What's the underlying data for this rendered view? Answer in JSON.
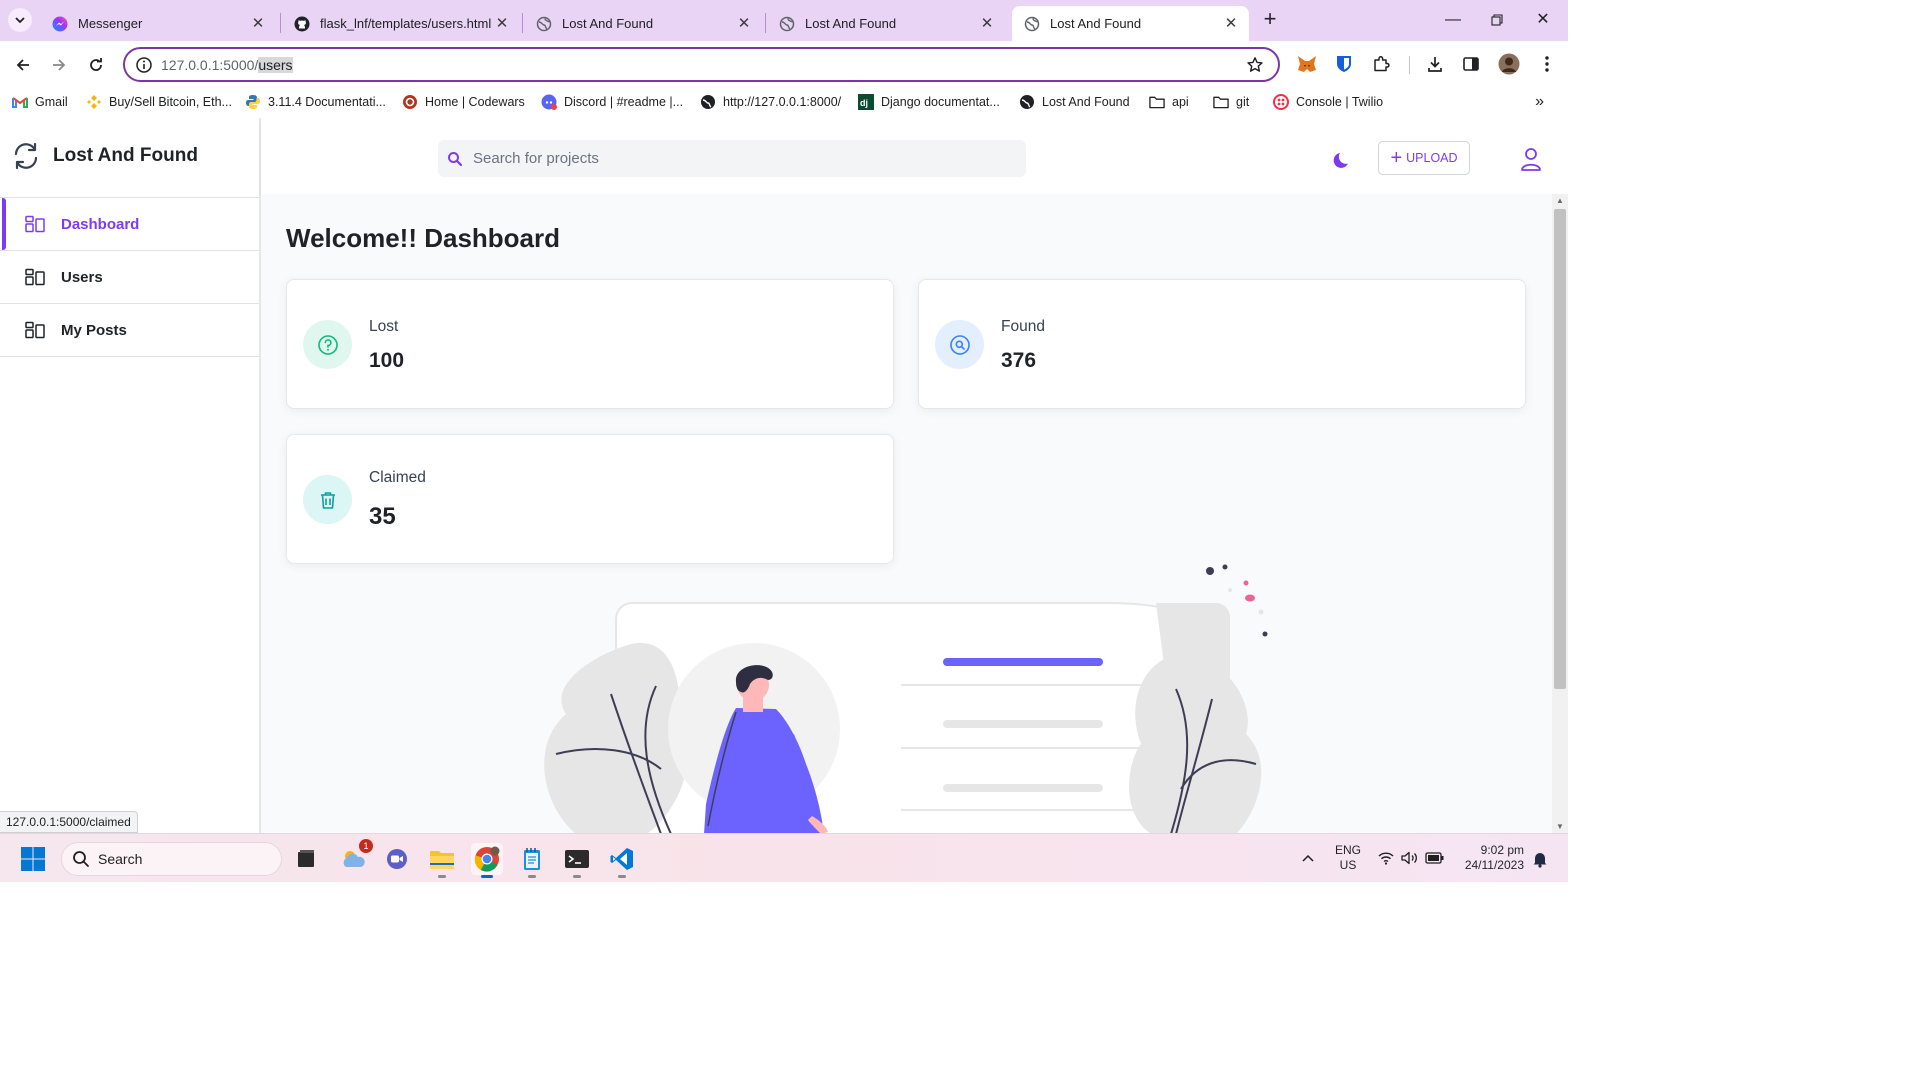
{
  "browser": {
    "tabs": [
      {
        "title": "Messenger",
        "favicon": "messenger-icon",
        "active": false
      },
      {
        "title": "flask_lnf/templates/users.html at",
        "favicon": "github-icon",
        "active": false
      },
      {
        "title": "Lost And Found",
        "favicon": "globe-icon",
        "active": false
      },
      {
        "title": "Lost And Found",
        "favicon": "globe-icon",
        "active": false
      },
      {
        "title": "Lost And Found",
        "favicon": "globe-icon",
        "active": true
      }
    ],
    "url_host": "127.0.0.1:5000/",
    "url_path": "users",
    "bookmarks": [
      {
        "label": "Gmail",
        "icon": "gmail-icon"
      },
      {
        "label": "Buy/Sell Bitcoin, Eth...",
        "icon": "binance-icon"
      },
      {
        "label": "3.11.4 Documentati...",
        "icon": "python-icon"
      },
      {
        "label": "Home | Codewars",
        "icon": "codewars-icon"
      },
      {
        "label": "Discord | #readme |...",
        "icon": "discord-icon"
      },
      {
        "label": "http://127.0.0.1:8000/",
        "icon": "globe-icon"
      },
      {
        "label": "Django documentat...",
        "icon": "django-icon"
      },
      {
        "label": "Lost And Found",
        "icon": "globe-icon"
      },
      {
        "label": "api",
        "icon": "folder-icon"
      },
      {
        "label": "git",
        "icon": "folder-icon"
      },
      {
        "label": "Console | Twilio",
        "icon": "twilio-icon"
      }
    ],
    "status_url": "127.0.0.1:5000/claimed"
  },
  "app": {
    "brand": "Lost And Found",
    "nav": [
      {
        "label": "Dashboard",
        "active": true
      },
      {
        "label": "Users",
        "active": false
      },
      {
        "label": "My Posts",
        "active": false
      }
    ],
    "search_placeholder": "Search for projects",
    "upload_label": "UPLOAD",
    "page_title": "Welcome!! Dashboard",
    "stats": [
      {
        "label": "Lost",
        "value": "100",
        "icon": "question-icon",
        "color": "#10b981",
        "bg": "#dff7ee"
      },
      {
        "label": "Found",
        "value": "376",
        "icon": "search-circle-icon",
        "color": "#3b82f6",
        "bg": "#e3eefe"
      },
      {
        "label": "Claimed",
        "value": "35",
        "icon": "trash-icon",
        "color": "#0e9f9f",
        "bg": "#dcf5f5"
      }
    ],
    "accent_color": "#7e3af2"
  },
  "taskbar": {
    "search_label": "Search",
    "weather_badge": "1",
    "lang": "ENG",
    "region": "US",
    "time": "9:02 pm",
    "date": "24/11/2023"
  }
}
